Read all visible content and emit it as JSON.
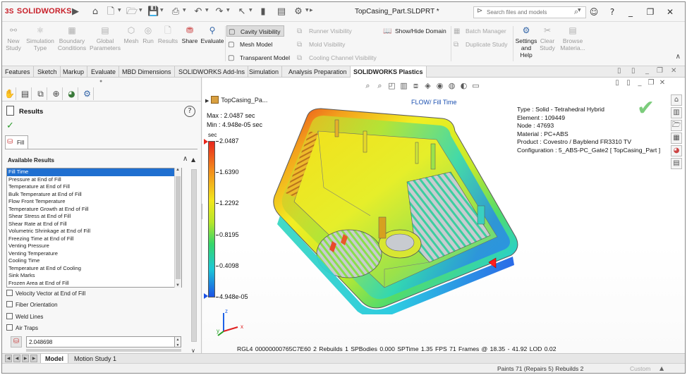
{
  "app": {
    "brand_ds": "3S",
    "brand_name": "SOLIDWORKS",
    "document_title": "TopCasing_Part.SLDPRT *"
  },
  "search": {
    "placeholder": "Search files and models"
  },
  "ribbon": {
    "new_study": [
      "New",
      "Study"
    ],
    "simulation_type": [
      "Simulation",
      "Type"
    ],
    "boundary_conditions": [
      "Boundary",
      "Conditions"
    ],
    "global_parameters": [
      "Global",
      "Parameters"
    ],
    "mesh": "Mesh",
    "run": "Run",
    "results": "Results",
    "share": "Share",
    "evaluate": "Evaluate",
    "cavity_visibility": "Cavity Visibility",
    "mesh_model": "Mesh Model",
    "transparent_model": "Transparent Model",
    "runner_visibility": "Runner Visibility",
    "mold_visibility": "Mold Visibility",
    "cooling_channel_visibility": "Cooling Channel Visibility",
    "show_hide_domain": "Show/Hide Domain",
    "batch_manager": "Batch Manager",
    "duplicate_study": "Duplicate Study",
    "settings_and_help": [
      "Settings",
      "and",
      "Help"
    ],
    "clear_study": [
      "Clear",
      "Study"
    ],
    "browse_materials": [
      "Browse",
      "Materia..."
    ]
  },
  "tabs": [
    {
      "label": "Features"
    },
    {
      "label": "Sketch"
    },
    {
      "label": "Markup"
    },
    {
      "label": "Evaluate"
    },
    {
      "label": "MBD Dimensions"
    },
    {
      "label": "SOLIDWORKS Add-Ins"
    },
    {
      "label": "Simulation"
    },
    {
      "label": "Analysis Preparation"
    },
    {
      "label": "SOLIDWORKS Plastics"
    }
  ],
  "panel": {
    "title": "Results",
    "group_label": "Fill",
    "available_label": "Available Results",
    "results": [
      "Fill Time",
      "Pressure at End of Fill",
      "Temperature at End of Fill",
      "Bulk Temperature at End of Fill",
      "Flow Front Temperature",
      "Temperature Growth at End of Fill",
      "Shear Stress at End of Fill",
      "Shear Rate at End of Fill",
      "Volumetric Shrinkage at End of Fill",
      "Freezing Time at End of Fill",
      "Venting Pressure",
      "Venting Temperature",
      "Cooling Time",
      "Temperature at End of Cooling",
      "Sink Marks",
      "Frozen Area at End of Fill"
    ],
    "selected_index": 0,
    "checkboxes": [
      "Velocity Vector at End of Fill",
      "Fiber Orientation",
      "Weld Lines",
      "Air Traps"
    ],
    "value": "2.048698"
  },
  "viewport": {
    "tree_node": "TopCasing_Pa...",
    "plot_title": "FLOW/ Fill Time",
    "max_label": "Max : 2.0487 sec",
    "min_label": "Min : 4.948e-05 sec",
    "legend_unit": "sec",
    "legend_values": [
      "2.0487",
      "1.6390",
      "1.2292",
      "0.8195",
      "0.4098",
      "4.948e-05"
    ],
    "info": [
      "Type : Solid - Tetrahedral Hybrid",
      "Element : 109449",
      "Node : 47693",
      "Material : PC+ABS",
      "Product : Covestro / Bayblend FR3310 TV",
      "Configuration : 5_ABS-PC_Gate2 [ TopCasing_Part ]"
    ],
    "axis_x": "x",
    "axis_y": "y",
    "axis_z": "z",
    "status": "RGL4 00000000765C7E60    2 Rebuilds    1 SPBodies  0.000 SPTime   1.35 FPS     71 Frames @ 18.35 - 41.92 LOD 0.02"
  },
  "bottom_tabs": [
    {
      "label": "Model"
    },
    {
      "label": "Motion Study 1"
    }
  ],
  "statusbar": {
    "paints": "Paints 71 (Repairs 5) Rebuilds 2",
    "custom": "Custom"
  }
}
